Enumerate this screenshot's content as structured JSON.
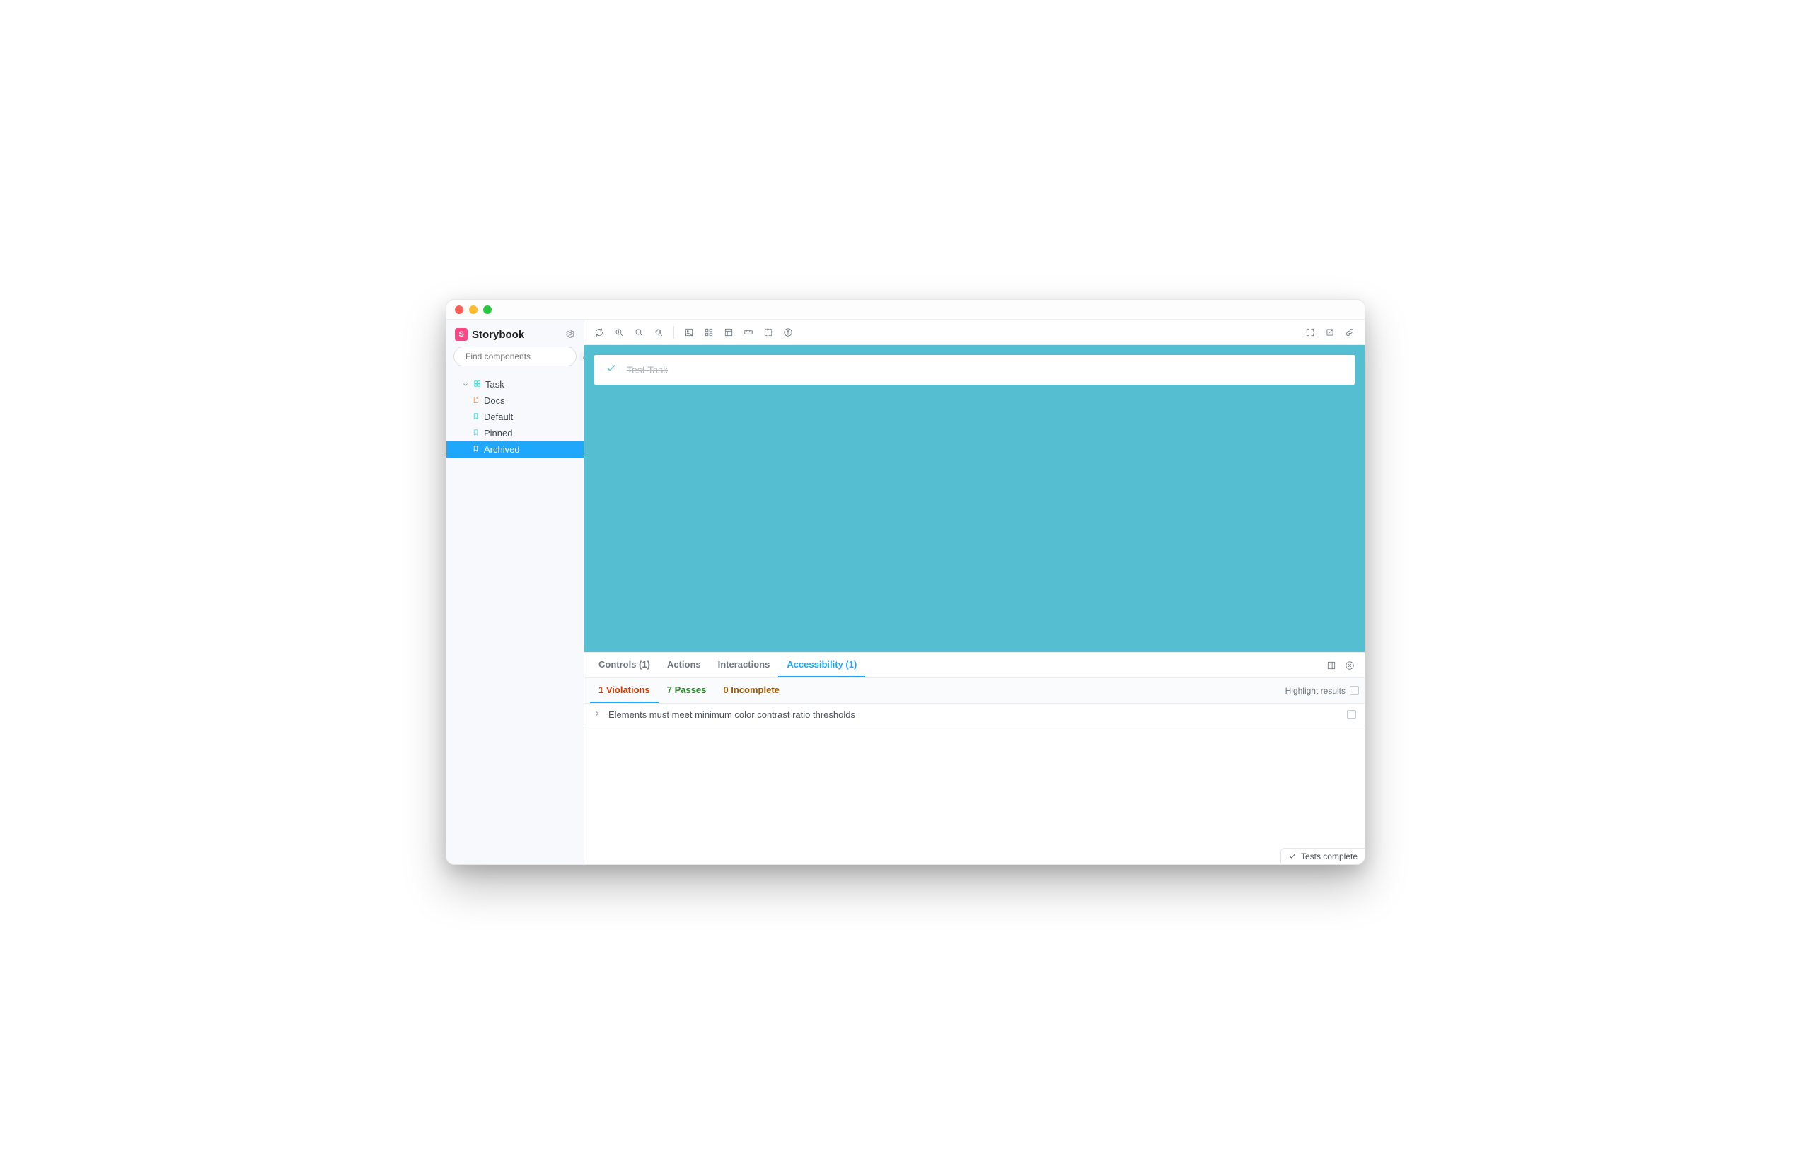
{
  "brand": {
    "name": "Storybook",
    "logo_letter": "S"
  },
  "search": {
    "placeholder": "Find components",
    "shortcut": "/"
  },
  "sidebar": {
    "component": "Task",
    "items": [
      {
        "label": "Docs",
        "kind": "docs"
      },
      {
        "label": "Default",
        "kind": "story"
      },
      {
        "label": "Pinned",
        "kind": "story"
      },
      {
        "label": "Archived",
        "kind": "story",
        "selected": true
      }
    ]
  },
  "canvas": {
    "task_title": "Test Task",
    "background": "#55bed0"
  },
  "addon_tabs": {
    "controls": {
      "label": "Controls",
      "count": 1
    },
    "actions": {
      "label": "Actions"
    },
    "interactions": {
      "label": "Interactions"
    },
    "accessibility": {
      "label": "Accessibility",
      "count": 1
    }
  },
  "a11y": {
    "violations": {
      "label": "Violations",
      "count": 1
    },
    "passes": {
      "label": "Passes",
      "count": 7
    },
    "incomplete": {
      "label": "Incomplete",
      "count": 0
    },
    "highlight_label": "Highlight results",
    "rows": [
      "Elements must meet minimum color contrast ratio thresholds"
    ]
  },
  "status": {
    "label": "Tests complete"
  }
}
